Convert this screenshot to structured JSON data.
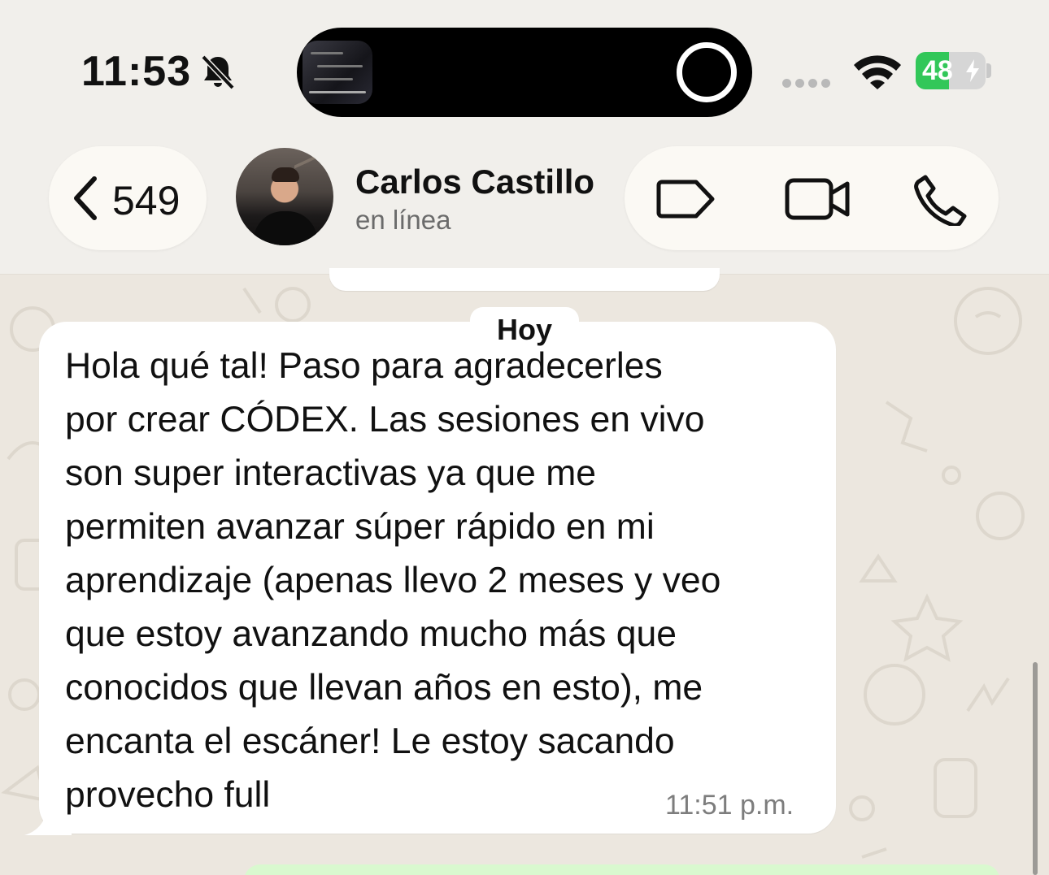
{
  "status_bar": {
    "time": "11:53",
    "battery_level": "48",
    "battery_fraction": 0.48,
    "colors": {
      "battery": "#32c759"
    }
  },
  "header": {
    "back_count": "549",
    "contact_name": "Carlos Castillo",
    "contact_status": "en línea",
    "icons": [
      "chevron-left-icon",
      "label-tag-icon",
      "video-call-icon",
      "phone-call-icon"
    ]
  },
  "chat": {
    "date_separator": "Hoy",
    "messages": [
      {
        "text": "Hola qué tal! Paso para agradecerles\npor crear CÓDEX. Las sesiones en vivo\nson super interactivas ya que me\npermiten avanzar súper rápido en mi\naprendizaje (apenas llevo 2 meses y veo\nque estoy avanzando mucho más que\nconocidos que llevan años en esto), me\nencanta el escáner! Le estoy sacando\nprovecho full",
        "time": "11:51 p.m.",
        "direction": "incoming"
      }
    ],
    "colors": {
      "outgoing_bubble": "#d9f9cf",
      "incoming_bubble": "#ffffff"
    }
  }
}
